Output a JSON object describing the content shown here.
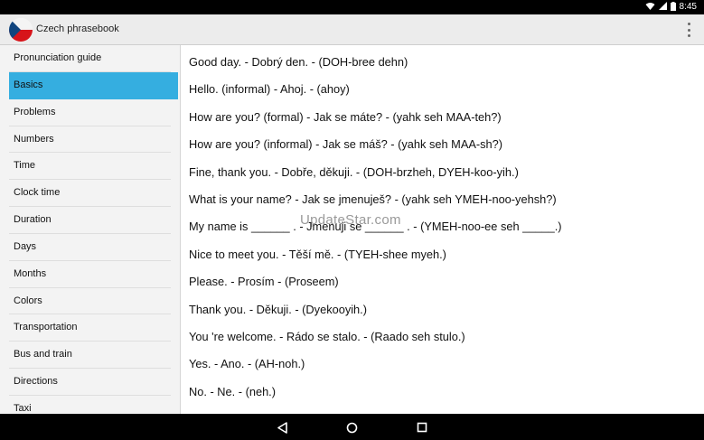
{
  "status_bar": {
    "time": "8:45"
  },
  "app_bar": {
    "title": "Czech phrasebook",
    "icon": "czech-flag-icon",
    "menu_icon": "overflow-menu-icon"
  },
  "sidebar": {
    "items": [
      {
        "label": "Pronunciation guide"
      },
      {
        "label": "Basics",
        "selected": true
      },
      {
        "label": "Problems"
      },
      {
        "label": "Numbers"
      },
      {
        "label": "Time"
      },
      {
        "label": "Clock time"
      },
      {
        "label": "Duration"
      },
      {
        "label": "Days"
      },
      {
        "label": "Months"
      },
      {
        "label": "Colors"
      },
      {
        "label": "Transportation"
      },
      {
        "label": "Bus and train"
      },
      {
        "label": "Directions"
      },
      {
        "label": "Taxi"
      }
    ]
  },
  "phrases": [
    "Good day. - Dobrý den. - (DOH-bree dehn)",
    "Hello. (informal) - Ahoj. - (ahoy)",
    "How are you? (formal) - Jak se máte? - (yahk seh MAA-teh?)",
    "How are you? (informal) - Jak se máš? - (yahk seh MAA-sh?)",
    "Fine, thank you. - Dobře, děkuji. - (DOH-brzheh, DYEH-koo-yih.)",
    "What is your name? - Jak se jmenuješ? - (yahk seh YMEH-noo-yehsh?)",
    "My name is ______ . - Jmenuji se ______ . - (YMEH-noo-ee seh _____.)",
    "Nice to meet you. - Těší mě. - (TYEH-shee myeh.)",
    "Please. - Prosím - (Proseem)",
    "Thank you. - Děkuji. - (Dyekooyih.)",
    "You 're welcome. - Rádo se stalo. - (Raado seh stulo.)",
    "Yes. - Ano. - (AH-noh.)",
    "No. - Ne. - (neh.)"
  ],
  "watermark": "UpdateStar.com",
  "navigation": {
    "back_icon": "back-icon",
    "home_icon": "home-icon",
    "recents_icon": "recents-icon"
  },
  "colors": {
    "accent": "#35aee0",
    "action_bar": "#ececec",
    "sidebar_bg": "#f3f3f3"
  }
}
